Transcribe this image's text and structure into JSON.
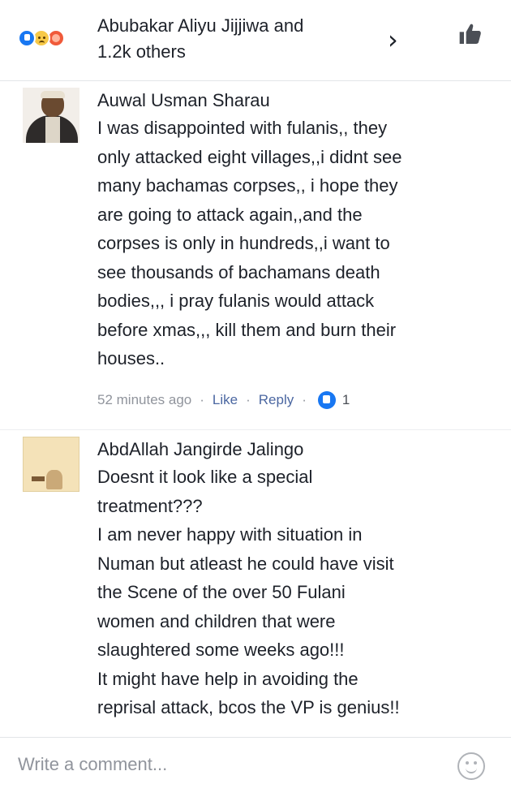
{
  "reactions": {
    "summary_line1": "Abubakar Aliyu Jijjiwa and",
    "summary_line2": "1.2k others",
    "icons": [
      "like-icon",
      "sad-icon",
      "angry-icon"
    ]
  },
  "comments": [
    {
      "author": "Auwal Usman Sharau",
      "text": "I was disappointed with fulanis,, they\nonly attacked eight villages,,i didnt see\nmany bachamas corpses,, i hope they\nare going to attack again,,and the\ncorpses is only in hundreds,,i want to\nsee thousands of bachamans death\nbodies,,, i pray fulanis would attack\nbefore xmas,,, kill them and burn their\nhouses..",
      "time": "52 minutes ago",
      "like_label": "Like",
      "reply_label": "Reply",
      "like_count": "1"
    },
    {
      "author": "AbdAllah Jangirde Jalingo",
      "text": "Doesnt it look like a special\ntreatment???\nI am never happy with situation in\nNuman but atleast he could have visit\nthe Scene of the over 50 Fulani\nwomen and children that were\nslaughtered some weeks ago!!!\nIt might have help in avoiding the\nreprisal attack, bcos the VP is genius!!"
    }
  ],
  "composer": {
    "placeholder": "Write a comment..."
  },
  "colors": {
    "facebook_blue": "#1877f2",
    "link": "#4b67a1",
    "meta_gray": "#90949c"
  }
}
